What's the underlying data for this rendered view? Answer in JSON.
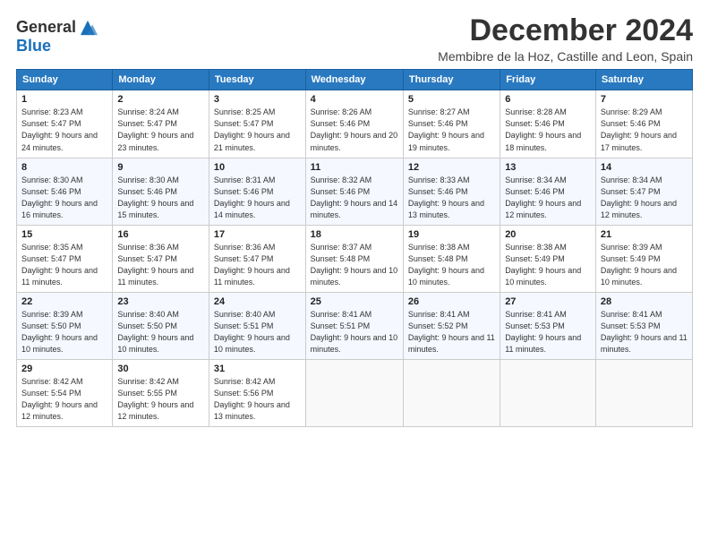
{
  "logo": {
    "line1": "General",
    "line2": "Blue"
  },
  "title": "December 2024",
  "location": "Membibre de la Hoz, Castille and Leon, Spain",
  "headers": [
    "Sunday",
    "Monday",
    "Tuesday",
    "Wednesday",
    "Thursday",
    "Friday",
    "Saturday"
  ],
  "weeks": [
    [
      {
        "day": "1",
        "sunrise": "8:23 AM",
        "sunset": "5:47 PM",
        "daylight": "9 hours and 24 minutes."
      },
      {
        "day": "2",
        "sunrise": "8:24 AM",
        "sunset": "5:47 PM",
        "daylight": "9 hours and 23 minutes."
      },
      {
        "day": "3",
        "sunrise": "8:25 AM",
        "sunset": "5:47 PM",
        "daylight": "9 hours and 21 minutes."
      },
      {
        "day": "4",
        "sunrise": "8:26 AM",
        "sunset": "5:46 PM",
        "daylight": "9 hours and 20 minutes."
      },
      {
        "day": "5",
        "sunrise": "8:27 AM",
        "sunset": "5:46 PM",
        "daylight": "9 hours and 19 minutes."
      },
      {
        "day": "6",
        "sunrise": "8:28 AM",
        "sunset": "5:46 PM",
        "daylight": "9 hours and 18 minutes."
      },
      {
        "day": "7",
        "sunrise": "8:29 AM",
        "sunset": "5:46 PM",
        "daylight": "9 hours and 17 minutes."
      }
    ],
    [
      {
        "day": "8",
        "sunrise": "8:30 AM",
        "sunset": "5:46 PM",
        "daylight": "9 hours and 16 minutes."
      },
      {
        "day": "9",
        "sunrise": "8:30 AM",
        "sunset": "5:46 PM",
        "daylight": "9 hours and 15 minutes."
      },
      {
        "day": "10",
        "sunrise": "8:31 AM",
        "sunset": "5:46 PM",
        "daylight": "9 hours and 14 minutes."
      },
      {
        "day": "11",
        "sunrise": "8:32 AM",
        "sunset": "5:46 PM",
        "daylight": "9 hours and 14 minutes."
      },
      {
        "day": "12",
        "sunrise": "8:33 AM",
        "sunset": "5:46 PM",
        "daylight": "9 hours and 13 minutes."
      },
      {
        "day": "13",
        "sunrise": "8:34 AM",
        "sunset": "5:46 PM",
        "daylight": "9 hours and 12 minutes."
      },
      {
        "day": "14",
        "sunrise": "8:34 AM",
        "sunset": "5:47 PM",
        "daylight": "9 hours and 12 minutes."
      }
    ],
    [
      {
        "day": "15",
        "sunrise": "8:35 AM",
        "sunset": "5:47 PM",
        "daylight": "9 hours and 11 minutes."
      },
      {
        "day": "16",
        "sunrise": "8:36 AM",
        "sunset": "5:47 PM",
        "daylight": "9 hours and 11 minutes."
      },
      {
        "day": "17",
        "sunrise": "8:36 AM",
        "sunset": "5:47 PM",
        "daylight": "9 hours and 11 minutes."
      },
      {
        "day": "18",
        "sunrise": "8:37 AM",
        "sunset": "5:48 PM",
        "daylight": "9 hours and 10 minutes."
      },
      {
        "day": "19",
        "sunrise": "8:38 AM",
        "sunset": "5:48 PM",
        "daylight": "9 hours and 10 minutes."
      },
      {
        "day": "20",
        "sunrise": "8:38 AM",
        "sunset": "5:49 PM",
        "daylight": "9 hours and 10 minutes."
      },
      {
        "day": "21",
        "sunrise": "8:39 AM",
        "sunset": "5:49 PM",
        "daylight": "9 hours and 10 minutes."
      }
    ],
    [
      {
        "day": "22",
        "sunrise": "8:39 AM",
        "sunset": "5:50 PM",
        "daylight": "9 hours and 10 minutes."
      },
      {
        "day": "23",
        "sunrise": "8:40 AM",
        "sunset": "5:50 PM",
        "daylight": "9 hours and 10 minutes."
      },
      {
        "day": "24",
        "sunrise": "8:40 AM",
        "sunset": "5:51 PM",
        "daylight": "9 hours and 10 minutes."
      },
      {
        "day": "25",
        "sunrise": "8:41 AM",
        "sunset": "5:51 PM",
        "daylight": "9 hours and 10 minutes."
      },
      {
        "day": "26",
        "sunrise": "8:41 AM",
        "sunset": "5:52 PM",
        "daylight": "9 hours and 11 minutes."
      },
      {
        "day": "27",
        "sunrise": "8:41 AM",
        "sunset": "5:53 PM",
        "daylight": "9 hours and 11 minutes."
      },
      {
        "day": "28",
        "sunrise": "8:41 AM",
        "sunset": "5:53 PM",
        "daylight": "9 hours and 11 minutes."
      }
    ],
    [
      {
        "day": "29",
        "sunrise": "8:42 AM",
        "sunset": "5:54 PM",
        "daylight": "9 hours and 12 minutes."
      },
      {
        "day": "30",
        "sunrise": "8:42 AM",
        "sunset": "5:55 PM",
        "daylight": "9 hours and 12 minutes."
      },
      {
        "day": "31",
        "sunrise": "8:42 AM",
        "sunset": "5:56 PM",
        "daylight": "9 hours and 13 minutes."
      },
      null,
      null,
      null,
      null
    ]
  ]
}
